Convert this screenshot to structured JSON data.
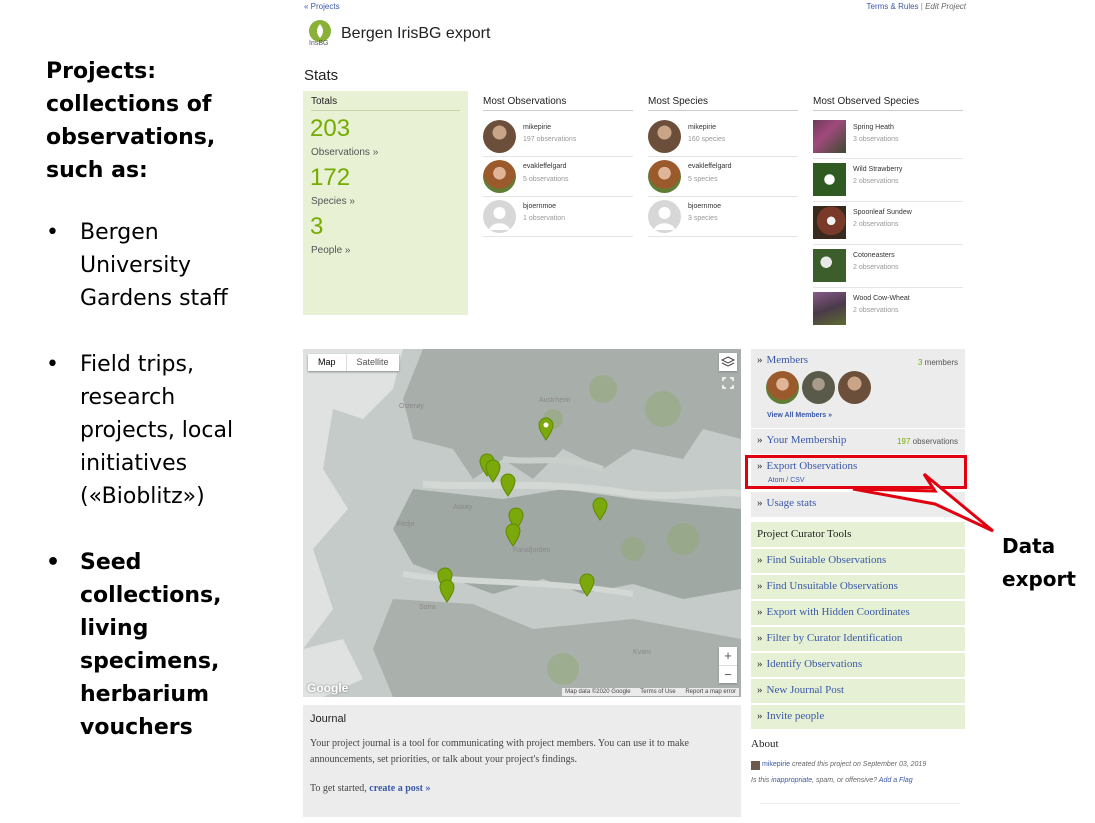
{
  "slide": {
    "heading_lines": [
      "Projects:",
      "collections of",
      "observations,",
      "such as:"
    ],
    "bullets": [
      {
        "lines": [
          "Bergen",
          "University",
          "Gardens staff"
        ],
        "bold": false
      },
      {
        "lines": [
          "Field trips,",
          "research",
          "projects, local",
          "initiatives",
          "(«Bioblitz»)"
        ],
        "bold": false
      },
      {
        "lines": [
          "Seed",
          "collections,",
          "living",
          "specimens,",
          "herbarium",
          "vouchers"
        ],
        "bold": true
      }
    ],
    "bullet_char": "•",
    "callout_lines": [
      "Data",
      "export"
    ],
    "callout_color": "#e0000f"
  },
  "header": {
    "breadcrumb": "« Projects",
    "terms": "Terms & Rules",
    "separator": "|",
    "edit": "Edit Project",
    "logo_text": "IrisBG",
    "title": "Bergen IrisBG export"
  },
  "stats": {
    "heading": "Stats",
    "totals_label": "Totals",
    "totals": [
      {
        "value": "203",
        "label": "Observations »"
      },
      {
        "value": "172",
        "label": "Species »"
      },
      {
        "value": "3",
        "label": "People »"
      }
    ],
    "most_observations": {
      "heading": "Most Observations",
      "users": [
        {
          "name": "mikepirie",
          "count": "197 observations"
        },
        {
          "name": "evakleffelgard",
          "count": "5 observations"
        },
        {
          "name": "bjoernmoe",
          "count": "1 observation"
        }
      ]
    },
    "most_species": {
      "heading": "Most Species",
      "users": [
        {
          "name": "mikepirie",
          "count": "160 species"
        },
        {
          "name": "evakleffelgard",
          "count": "5 species"
        },
        {
          "name": "bjoernmoe",
          "count": "3 species"
        }
      ]
    },
    "most_observed_species": {
      "heading": "Most Observed Species",
      "species": [
        {
          "name": "Spring Heath",
          "count": "3 observations"
        },
        {
          "name": "Wild Strawberry",
          "count": "2 observations"
        },
        {
          "name": "Spoonleaf Sundew",
          "count": "2 observations"
        },
        {
          "name": "Cotoneasters",
          "count": "2 observations"
        },
        {
          "name": "Wood Cow-Wheat",
          "count": "2 observations"
        }
      ]
    }
  },
  "map": {
    "tab_map": "Map",
    "tab_satellite": "Satellite",
    "google": "Google",
    "attribution": "Map data ©2020 Google",
    "terms": "Terms of Use",
    "report": "Report a map error",
    "zoom_in": "+",
    "zoom_out": "−",
    "place_labels": [
      "Austrheim",
      "Osterøy",
      "Fedje",
      "Askøy",
      "Sotra",
      "Fanafjorden",
      "Kvam"
    ]
  },
  "sidebar": {
    "members_label": "Members",
    "members_count": "3",
    "members_suffix": "members",
    "view_all": "View All Members »",
    "membership_label": "Your Membership",
    "membership_count": "197",
    "membership_suffix": "observations",
    "export_label": "Export Observations",
    "export_atom": "Atom",
    "export_sep": "/",
    "export_csv": "CSV",
    "usage_label": "Usage stats",
    "curator_heading": "Project Curator Tools",
    "curator_tools": [
      "Find Suitable Observations",
      "Find Unsuitable Observations",
      "Export with Hidden Coordinates",
      "Filter by Curator Identification",
      "Identify Observations",
      "New Journal Post",
      "Invite people"
    ],
    "about_heading": "About",
    "about_user": "mikepirie",
    "about_text": "created this project on September 03, 2019",
    "flag_prefix": "Is this",
    "flag_inappropriate": "inappropriate",
    "flag_mid": ", spam, or offensive?",
    "flag_link": "Add a Flag"
  },
  "journal": {
    "title": "Journal",
    "body": "Your project journal is a tool for communicating with project members. You can use it to make announcements, set priorities, or talk about your project's findings.",
    "start_prefix": "To get started,",
    "start_link": "create a post »"
  },
  "colors": {
    "accent_green": "#74ac00",
    "link_blue": "#3a58a8",
    "totals_bg": "#e8f1d4"
  }
}
